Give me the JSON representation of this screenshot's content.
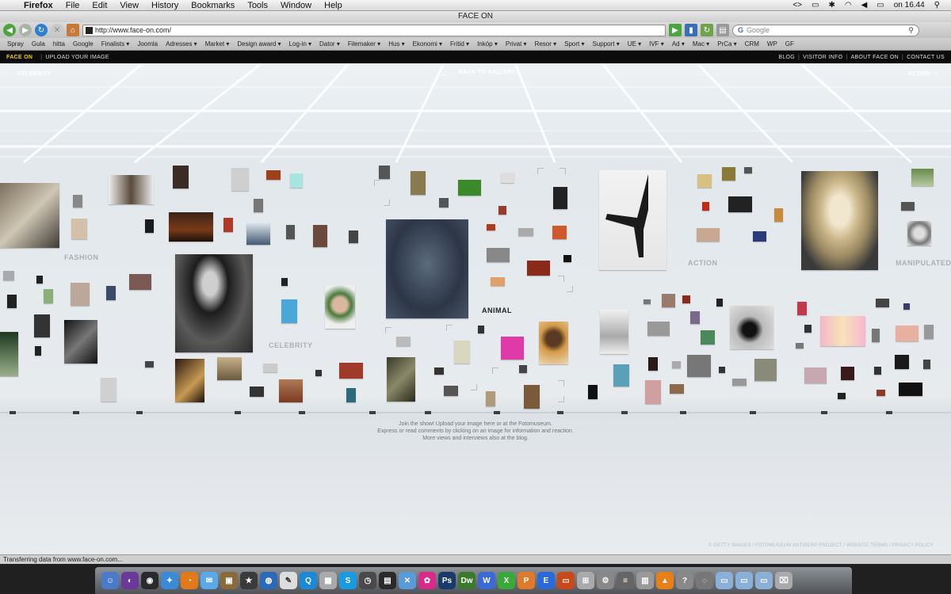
{
  "menubar": {
    "app": "Firefox",
    "items": [
      "File",
      "Edit",
      "View",
      "History",
      "Bookmarks",
      "Tools",
      "Window",
      "Help"
    ],
    "clock": "on 16.44"
  },
  "window": {
    "title": "FACE ON"
  },
  "toolbar": {
    "url": "http://www.face-on.com/",
    "search_placeholder": "Google"
  },
  "bookmarks": [
    "Spray",
    "Gula",
    "hitta",
    "Google",
    "Finalists ▾",
    "Joomla",
    "Adresses ▾",
    "Market ▾",
    "Design award ▾",
    "Log-in ▾",
    "Dator ▾",
    "Filemaker ▾",
    "Hus ▾",
    "Ekonomi ▾",
    "Fritid ▾",
    "Inköp ▾",
    "Privat ▾",
    "Resor ▾",
    "Sport ▾",
    "Support ▾",
    "UE ▾",
    "IVF ▾",
    "Ad ▾",
    "Mac ▾",
    "PrCa ▾",
    "CRM",
    "WP",
    "GF"
  ],
  "site": {
    "logo": "FACE ON",
    "upload": "UPLOAD YOUR IMAGE",
    "links": [
      "BLOG",
      "VISITOR INFO",
      "ABOUT FACE ON",
      "CONTACT US"
    ]
  },
  "gallery": {
    "nav_left": "CELEBRITY",
    "nav_center": "BACK TO GALLERY",
    "nav_right": "ACTION",
    "wall_labels": {
      "fashion": "FASHION",
      "celebrity": "CELEBRITY",
      "animal": "ANIMAL",
      "action": "ACTION",
      "manipulated": "MANIPULATED"
    },
    "message": [
      "Join the show! Upload your image here or at the Fotomuseum.",
      "Express or read comments by clicking on an image for information and reaction.",
      "More views and interviews also at the blog."
    ],
    "credits": "© GETTY IMAGES / FOTOMUSEUM ANTWERP PROJECT / WEBSITE TERMS / PRIVACY POLICY"
  },
  "status": "Transferring data from www.face-on.com..."
}
